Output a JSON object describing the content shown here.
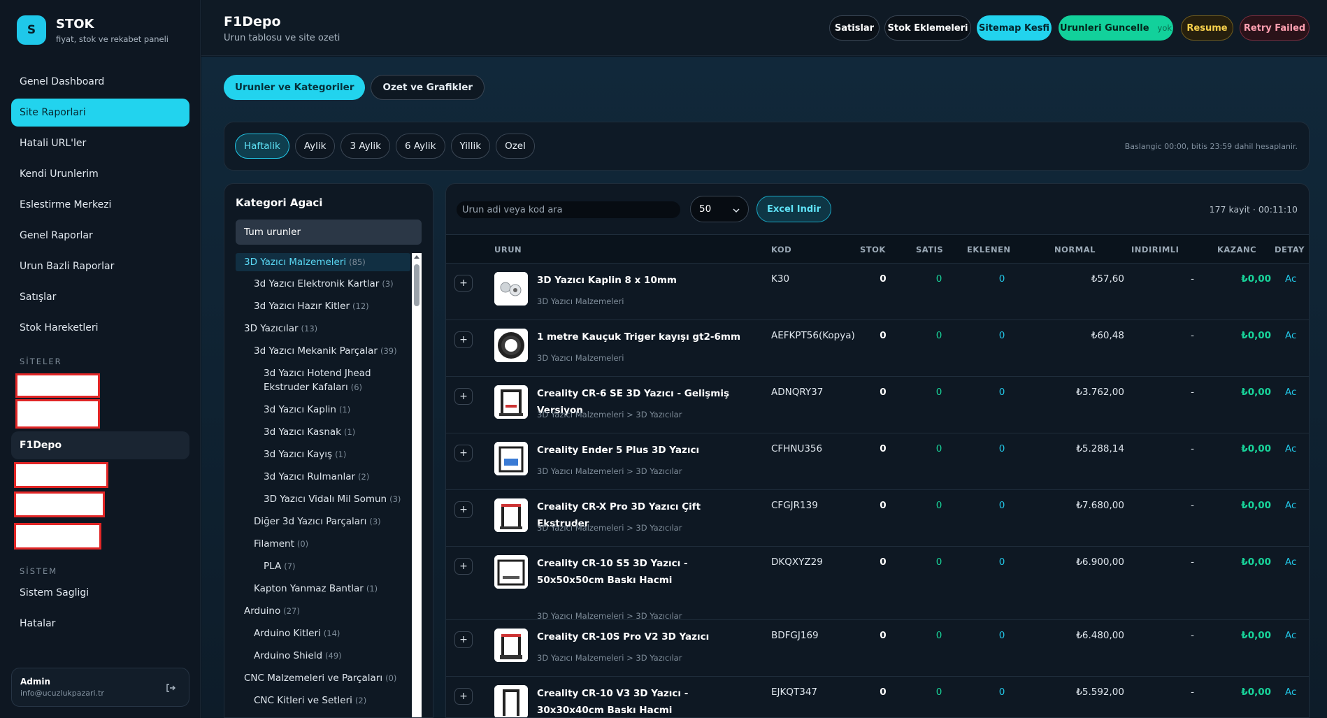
{
  "brand": {
    "logo": "S",
    "title": "STOK",
    "subtitle": "fiyat, stok ve rekabet paneli"
  },
  "nav": [
    "Genel Dashboard",
    "Site Raporlari",
    "Hatali URL'ler",
    "Kendi Urunlerim",
    "Eslestirme Merkezi",
    "Genel Raporlar",
    "Urun Bazli Raporlar",
    "Satışlar",
    "Stok Hareketleri"
  ],
  "sites_title": "SİTELER",
  "active_site": "F1Depo",
  "system_title": "SİSTEM",
  "system_items": [
    "Sistem Sagligi",
    "Hatalar"
  ],
  "admin": {
    "name": "Admin",
    "email": "info@ucuzlukpazari.tr"
  },
  "header": {
    "title": "F1Depo",
    "subtitle": "Urun tablosu ve site ozeti",
    "buttons": {
      "satislar": "Satislar",
      "stok_eklemeleri": "Stok Eklemeleri",
      "sitemap": "Sitemap Kesfi",
      "guncelle": "Urunleri Guncelle",
      "guncelle_tag": "yok",
      "resume": "Resume",
      "retry": "Retry Failed"
    }
  },
  "tabs": [
    "Urunler ve Kategoriler",
    "Ozet ve Grafikler"
  ],
  "periods": [
    "Haftalik",
    "Aylik",
    "3 Aylik",
    "6 Aylik",
    "Yillik",
    "Ozel"
  ],
  "period_note": "Baslangic 00:00, bitis 23:59 dahil hesaplanir.",
  "category": {
    "title": "Kategori Agaci",
    "all": "Tum urunler",
    "items": [
      {
        "label": "3D Yazıcı Malzemeleri",
        "count": "(85)"
      },
      {
        "label": "3d Yazıcı Elektronik Kartlar",
        "count": "(3)"
      },
      {
        "label": "3d Yazıcı Hazır Kitler",
        "count": "(12)"
      },
      {
        "label": "3D Yazıcılar",
        "count": "(13)"
      },
      {
        "label": "3d Yazıcı Mekanik Parçalar",
        "count": "(39)"
      },
      {
        "label": "3d Yazıcı Hotend Jhead Ekstruder Kafaları",
        "count": "(6)"
      },
      {
        "label": "3d Yazıcı Kaplin",
        "count": "(1)"
      },
      {
        "label": "3d Yazıcı Kasnak",
        "count": "(1)"
      },
      {
        "label": "3d Yazıcı Kayış",
        "count": "(1)"
      },
      {
        "label": "3d Yazıcı Rulmanlar",
        "count": "(2)"
      },
      {
        "label": "3D Yazıcı Vidalı Mil Somun",
        "count": "(3)"
      },
      {
        "label": "Diğer 3d Yazıcı Parçaları",
        "count": "(3)"
      },
      {
        "label": "Filament",
        "count": "(0)"
      },
      {
        "label": "PLA",
        "count": "(7)"
      },
      {
        "label": "Kapton Yanmaz Bantlar",
        "count": "(1)"
      },
      {
        "label": "Arduino",
        "count": "(27)"
      },
      {
        "label": "Arduino Kitleri",
        "count": "(14)"
      },
      {
        "label": "Arduino Shield",
        "count": "(49)"
      },
      {
        "label": "CNC Malzemeleri ve Parçaları",
        "count": "(0)"
      },
      {
        "label": "CNC Kitleri ve Setleri",
        "count": "(2)"
      }
    ]
  },
  "products": {
    "search_placeholder": "Urun adi veya kod ara",
    "page_size": "50",
    "excel": "Excel Indir",
    "record_info": "177 kayit · 00:11:10",
    "columns": [
      "URUN",
      "KOD",
      "STOK",
      "SATIS",
      "EKLENEN",
      "NORMAL",
      "INDIRIMLI",
      "KAZANC",
      "DETAY"
    ],
    "rows": [
      {
        "name": "3D Yazıcı Kaplin 8 x 10mm",
        "category": "3D Yazıcı Malzemeleri",
        "code": "K30",
        "stok": "0",
        "satis": "0",
        "eklenen": "0",
        "normal": "₺57,60",
        "indirimli": "-",
        "kazanc": "₺0,00",
        "detay": "Ac"
      },
      {
        "name": "1 metre Kauçuk Triger kayışı gt2-6mm",
        "category": "3D Yazıcı Malzemeleri",
        "code": "AEFKPT56(Kopya)",
        "stok": "0",
        "satis": "0",
        "eklenen": "0",
        "normal": "₺60,48",
        "indirimli": "-",
        "kazanc": "₺0,00",
        "detay": "Ac"
      },
      {
        "name": "Creality CR-6 SE 3D Yazıcı - Gelişmiş Versiyon",
        "category": "3D Yazıcı Malzemeleri > 3D Yazıcılar",
        "code": "ADNQRY37",
        "stok": "0",
        "satis": "0",
        "eklenen": "0",
        "normal": "₺3.762,00",
        "indirimli": "-",
        "kazanc": "₺0,00",
        "detay": "Ac"
      },
      {
        "name": "Creality Ender 5 Plus 3D Yazıcı",
        "category": "3D Yazıcı Malzemeleri > 3D Yazıcılar",
        "code": "CFHNU356",
        "stok": "0",
        "satis": "0",
        "eklenen": "0",
        "normal": "₺5.288,14",
        "indirimli": "-",
        "kazanc": "₺0,00",
        "detay": "Ac"
      },
      {
        "name": "Creality CR-X Pro 3D Yazıcı Çift Ekstruder",
        "category": "3D Yazıcı Malzemeleri > 3D Yazıcılar",
        "code": "CFGJR139",
        "stok": "0",
        "satis": "0",
        "eklenen": "0",
        "normal": "₺7.680,00",
        "indirimli": "-",
        "kazanc": "₺0,00",
        "detay": "Ac"
      },
      {
        "name": "Creality CR-10 S5 3D Yazıcı - 50x50x50cm Baskı Hacmi",
        "category": "3D Yazıcı Malzemeleri > 3D Yazıcılar",
        "code": "DKQXYZ29",
        "stok": "0",
        "satis": "0",
        "eklenen": "0",
        "normal": "₺6.900,00",
        "indirimli": "-",
        "kazanc": "₺0,00",
        "detay": "Ac"
      },
      {
        "name": "Creality CR-10S Pro V2 3D Yazıcı",
        "category": "3D Yazıcı Malzemeleri > 3D Yazıcılar",
        "code": "BDFGJ169",
        "stok": "0",
        "satis": "0",
        "eklenen": "0",
        "normal": "₺6.480,00",
        "indirimli": "-",
        "kazanc": "₺0,00",
        "detay": "Ac"
      },
      {
        "name": "Creality CR-10 V3 3D Yazıcı - 30x30x40cm Baskı Hacmi",
        "category": "",
        "code": "EJKQT347",
        "stok": "0",
        "satis": "0",
        "eklenen": "0",
        "normal": "₺5.592,00",
        "indirimli": "-",
        "kazanc": "₺0,00",
        "detay": "Ac"
      }
    ]
  }
}
